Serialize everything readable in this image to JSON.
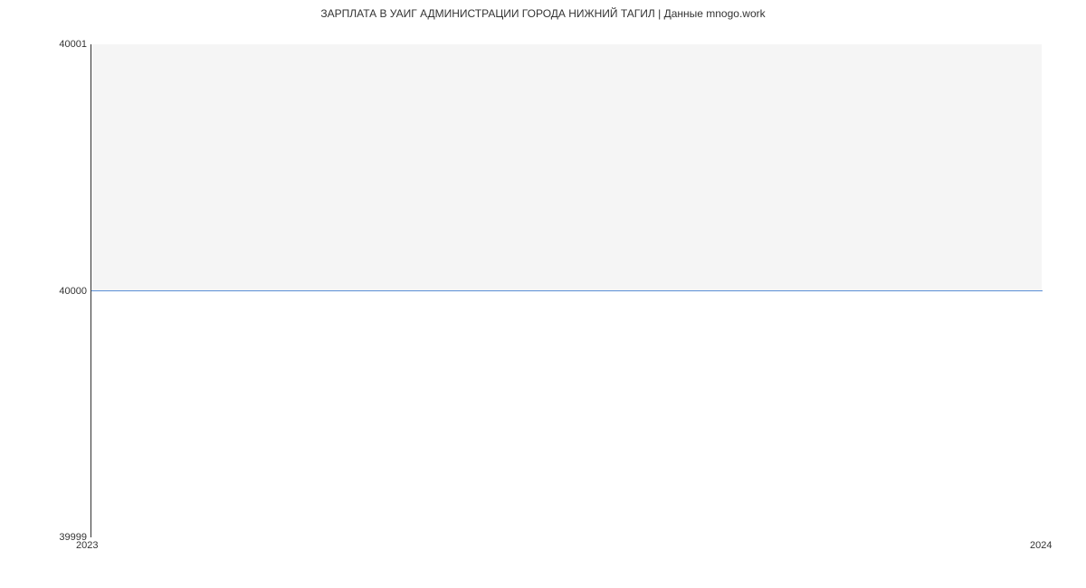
{
  "chart_data": {
    "type": "line",
    "title": "ЗАРПЛАТА В УАИГ АДМИНИСТРАЦИИ ГОРОДА НИЖНИЙ  ТАГИЛ | Данные mnogo.work",
    "x": [
      2023,
      2024
    ],
    "values": [
      40000,
      40000
    ],
    "xlabel": "",
    "ylabel": "",
    "ylim": [
      39999,
      40001
    ],
    "y_ticks": [
      "39999",
      "40000",
      "40001"
    ],
    "x_ticks": [
      "2023",
      "2024"
    ]
  }
}
